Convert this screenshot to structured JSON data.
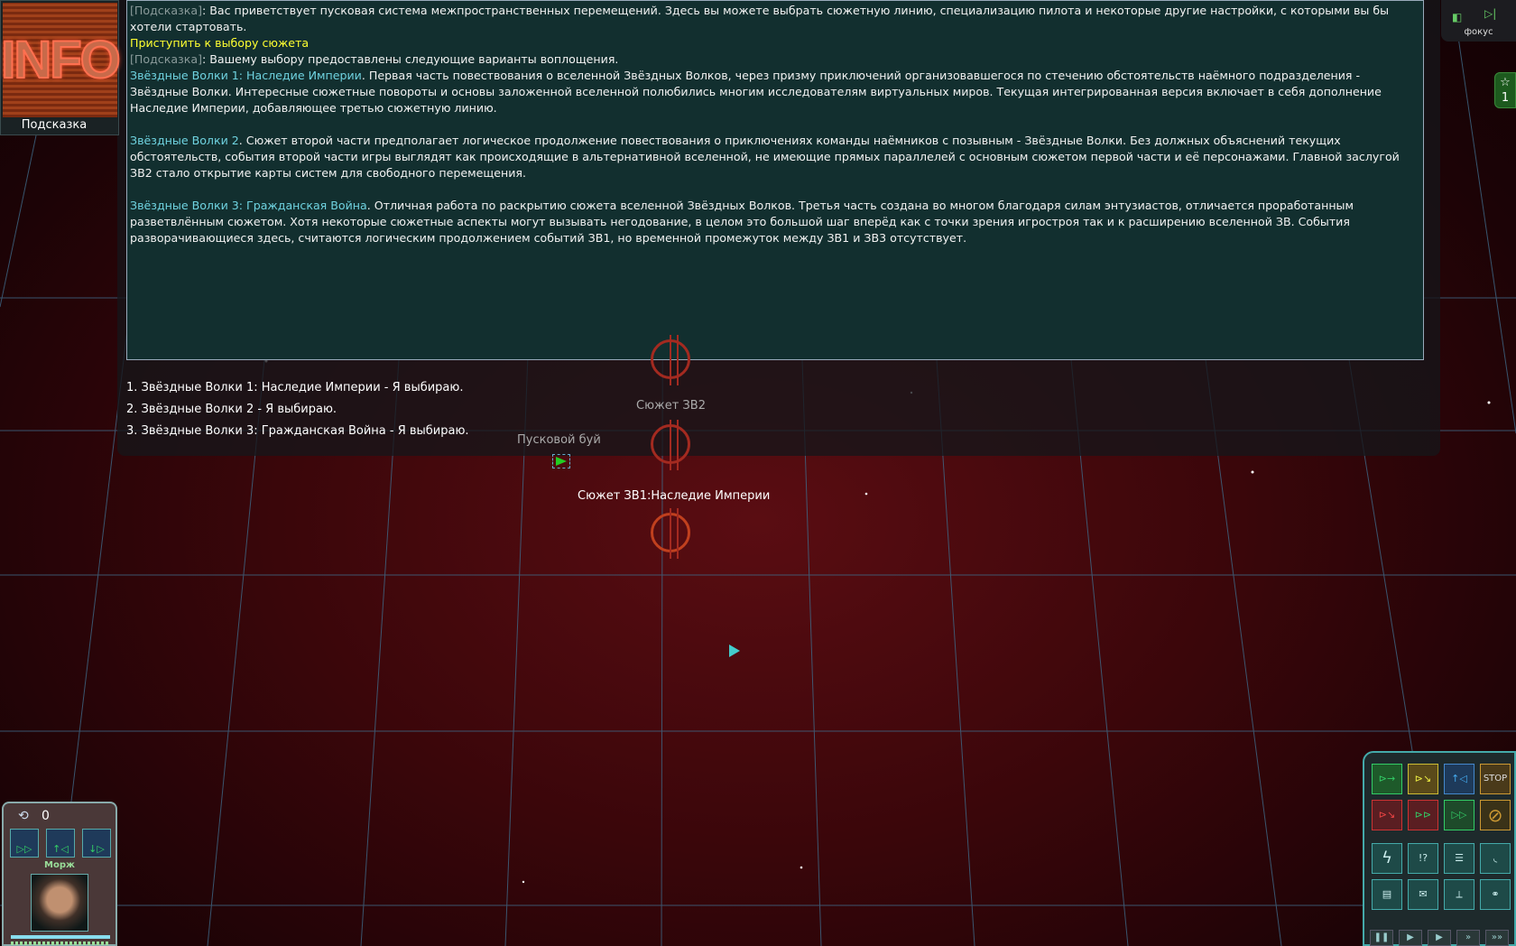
{
  "info": {
    "logo": "INFO",
    "label": "Подсказка"
  },
  "panel": {
    "hint_tag": "[Подсказка]",
    "intro": ": Вас приветствует пусковая система межпространственных перемещений. Здесь вы можете выбрать сюжетную линию, специализацию пилота и некоторые другие настройки, с которыми вы бы хотели стартовать.",
    "action": "Приступить к выбору сюжета",
    "intro2": ": Вашему выбору предоставлены следующие варианты воплощения.",
    "sw1_title": "Звёздные Волки 1: Наследие Империи",
    "sw1_text": ". Первая часть повествования о вселенной Звёздных Волков, через призму приключений организовавшегося по стечению обстоятельств наёмного подразделения - Звёздные Волки. Интересные сюжетные повороты и основы заложенной вселенной полюбились многим исследователям виртуальных миров. Текущая интегрированная версия включает в себя дополнение Наследие Империи, добавляющее третью сюжетную линию.",
    "sw2_title": "Звёздные Волки 2",
    "sw2_text": ". Сюжет второй части предполагает логическое продолжение повествования о приключениях команды наёмников с позывным - Звёздные Волки. Без должных объяснений текущих обстоятельств, события второй части игры выглядят как происходящие в альтернативной вселенной, не имеющие прямых параллелей с основным сюжетом первой части и её персонажами. Главной заслугой ЗВ2 стало открытие карты систем для свободного перемещения.",
    "sw3_title": "Звёздные Волки 3: Гражданская Война",
    "sw3_text": ". Отличная работа по раскрытию сюжета вселенной Звёздных Волков. Третья часть создана во многом благодаря силам энтузиастов, отличается проработанным разветвлённым сюжетом. Хотя некоторые сюжетные аспекты могут вызывать негодование, в целом это большой шаг вперёд как с точки зрения игростроя так и к расширению вселенной ЗВ. События разворачивающиеся здесь, считаются логическим продолжением событий ЗВ1, но временной промежуток между ЗВ1 и ЗВ3 отсутствует."
  },
  "choices": [
    "1. Звёздные Волки 1: Наследие Империи - Я выбираю.",
    "2. Звёздные Волки 2 - Я выбираю.",
    "3. Звёздные Волки 3: Гражданская Война - Я выбираю."
  ],
  "map": {
    "label_sw2": "Сюжет ЗВ2",
    "label_buoy": "Пусковой буй",
    "label_sw1": "Сюжет ЗВ1:Наследие Империи"
  },
  "focus": {
    "label": "фокус"
  },
  "badge": {
    "count": "1"
  },
  "squad": {
    "count": "0",
    "pilot": "Морж"
  },
  "commands": {
    "stop": "STOP"
  },
  "colors": {
    "panel_bg": "#122f2f",
    "hint": "#8a9a9a",
    "action": "#ffff30",
    "title": "#6fd3e0"
  }
}
